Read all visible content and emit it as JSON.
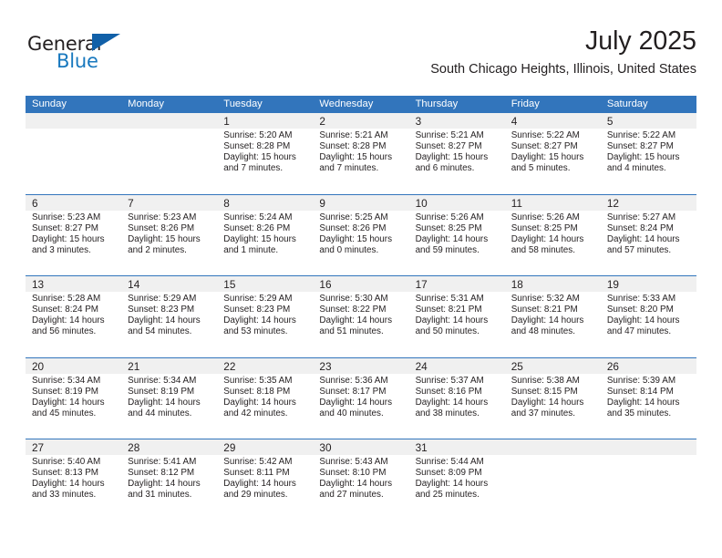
{
  "branding": {
    "logo_primary": "General",
    "logo_secondary": "Blue",
    "logo_triangle_icon": "triangle-icon",
    "colors": {
      "logo_text": "#231f20",
      "logo_blue": "#1878be",
      "logo_triangle": "#1160a8",
      "header_blue": "#3275bc",
      "daynum_strip": "#f0f0f0"
    }
  },
  "header": {
    "title": "July 2025",
    "subtitle": "South Chicago Heights, Illinois, United States"
  },
  "calendar": {
    "weekday_headers": [
      "Sunday",
      "Monday",
      "Tuesday",
      "Wednesday",
      "Thursday",
      "Friday",
      "Saturday"
    ],
    "weeks": [
      [
        {
          "day": "",
          "sunrise": "",
          "sunset": "",
          "daylight_line1": "",
          "daylight_line2": ""
        },
        {
          "day": "",
          "sunrise": "",
          "sunset": "",
          "daylight_line1": "",
          "daylight_line2": ""
        },
        {
          "day": "1",
          "sunrise": "Sunrise: 5:20 AM",
          "sunset": "Sunset: 8:28 PM",
          "daylight_line1": "Daylight: 15 hours",
          "daylight_line2": "and 7 minutes."
        },
        {
          "day": "2",
          "sunrise": "Sunrise: 5:21 AM",
          "sunset": "Sunset: 8:28 PM",
          "daylight_line1": "Daylight: 15 hours",
          "daylight_line2": "and 7 minutes."
        },
        {
          "day": "3",
          "sunrise": "Sunrise: 5:21 AM",
          "sunset": "Sunset: 8:27 PM",
          "daylight_line1": "Daylight: 15 hours",
          "daylight_line2": "and 6 minutes."
        },
        {
          "day": "4",
          "sunrise": "Sunrise: 5:22 AM",
          "sunset": "Sunset: 8:27 PM",
          "daylight_line1": "Daylight: 15 hours",
          "daylight_line2": "and 5 minutes."
        },
        {
          "day": "5",
          "sunrise": "Sunrise: 5:22 AM",
          "sunset": "Sunset: 8:27 PM",
          "daylight_line1": "Daylight: 15 hours",
          "daylight_line2": "and 4 minutes."
        }
      ],
      [
        {
          "day": "6",
          "sunrise": "Sunrise: 5:23 AM",
          "sunset": "Sunset: 8:27 PM",
          "daylight_line1": "Daylight: 15 hours",
          "daylight_line2": "and 3 minutes."
        },
        {
          "day": "7",
          "sunrise": "Sunrise: 5:23 AM",
          "sunset": "Sunset: 8:26 PM",
          "daylight_line1": "Daylight: 15 hours",
          "daylight_line2": "and 2 minutes."
        },
        {
          "day": "8",
          "sunrise": "Sunrise: 5:24 AM",
          "sunset": "Sunset: 8:26 PM",
          "daylight_line1": "Daylight: 15 hours",
          "daylight_line2": "and 1 minute."
        },
        {
          "day": "9",
          "sunrise": "Sunrise: 5:25 AM",
          "sunset": "Sunset: 8:26 PM",
          "daylight_line1": "Daylight: 15 hours",
          "daylight_line2": "and 0 minutes."
        },
        {
          "day": "10",
          "sunrise": "Sunrise: 5:26 AM",
          "sunset": "Sunset: 8:25 PM",
          "daylight_line1": "Daylight: 14 hours",
          "daylight_line2": "and 59 minutes."
        },
        {
          "day": "11",
          "sunrise": "Sunrise: 5:26 AM",
          "sunset": "Sunset: 8:25 PM",
          "daylight_line1": "Daylight: 14 hours",
          "daylight_line2": "and 58 minutes."
        },
        {
          "day": "12",
          "sunrise": "Sunrise: 5:27 AM",
          "sunset": "Sunset: 8:24 PM",
          "daylight_line1": "Daylight: 14 hours",
          "daylight_line2": "and 57 minutes."
        }
      ],
      [
        {
          "day": "13",
          "sunrise": "Sunrise: 5:28 AM",
          "sunset": "Sunset: 8:24 PM",
          "daylight_line1": "Daylight: 14 hours",
          "daylight_line2": "and 56 minutes."
        },
        {
          "day": "14",
          "sunrise": "Sunrise: 5:29 AM",
          "sunset": "Sunset: 8:23 PM",
          "daylight_line1": "Daylight: 14 hours",
          "daylight_line2": "and 54 minutes."
        },
        {
          "day": "15",
          "sunrise": "Sunrise: 5:29 AM",
          "sunset": "Sunset: 8:23 PM",
          "daylight_line1": "Daylight: 14 hours",
          "daylight_line2": "and 53 minutes."
        },
        {
          "day": "16",
          "sunrise": "Sunrise: 5:30 AM",
          "sunset": "Sunset: 8:22 PM",
          "daylight_line1": "Daylight: 14 hours",
          "daylight_line2": "and 51 minutes."
        },
        {
          "day": "17",
          "sunrise": "Sunrise: 5:31 AM",
          "sunset": "Sunset: 8:21 PM",
          "daylight_line1": "Daylight: 14 hours",
          "daylight_line2": "and 50 minutes."
        },
        {
          "day": "18",
          "sunrise": "Sunrise: 5:32 AM",
          "sunset": "Sunset: 8:21 PM",
          "daylight_line1": "Daylight: 14 hours",
          "daylight_line2": "and 48 minutes."
        },
        {
          "day": "19",
          "sunrise": "Sunrise: 5:33 AM",
          "sunset": "Sunset: 8:20 PM",
          "daylight_line1": "Daylight: 14 hours",
          "daylight_line2": "and 47 minutes."
        }
      ],
      [
        {
          "day": "20",
          "sunrise": "Sunrise: 5:34 AM",
          "sunset": "Sunset: 8:19 PM",
          "daylight_line1": "Daylight: 14 hours",
          "daylight_line2": "and 45 minutes."
        },
        {
          "day": "21",
          "sunrise": "Sunrise: 5:34 AM",
          "sunset": "Sunset: 8:19 PM",
          "daylight_line1": "Daylight: 14 hours",
          "daylight_line2": "and 44 minutes."
        },
        {
          "day": "22",
          "sunrise": "Sunrise: 5:35 AM",
          "sunset": "Sunset: 8:18 PM",
          "daylight_line1": "Daylight: 14 hours",
          "daylight_line2": "and 42 minutes."
        },
        {
          "day": "23",
          "sunrise": "Sunrise: 5:36 AM",
          "sunset": "Sunset: 8:17 PM",
          "daylight_line1": "Daylight: 14 hours",
          "daylight_line2": "and 40 minutes."
        },
        {
          "day": "24",
          "sunrise": "Sunrise: 5:37 AM",
          "sunset": "Sunset: 8:16 PM",
          "daylight_line1": "Daylight: 14 hours",
          "daylight_line2": "and 38 minutes."
        },
        {
          "day": "25",
          "sunrise": "Sunrise: 5:38 AM",
          "sunset": "Sunset: 8:15 PM",
          "daylight_line1": "Daylight: 14 hours",
          "daylight_line2": "and 37 minutes."
        },
        {
          "day": "26",
          "sunrise": "Sunrise: 5:39 AM",
          "sunset": "Sunset: 8:14 PM",
          "daylight_line1": "Daylight: 14 hours",
          "daylight_line2": "and 35 minutes."
        }
      ],
      [
        {
          "day": "27",
          "sunrise": "Sunrise: 5:40 AM",
          "sunset": "Sunset: 8:13 PM",
          "daylight_line1": "Daylight: 14 hours",
          "daylight_line2": "and 33 minutes."
        },
        {
          "day": "28",
          "sunrise": "Sunrise: 5:41 AM",
          "sunset": "Sunset: 8:12 PM",
          "daylight_line1": "Daylight: 14 hours",
          "daylight_line2": "and 31 minutes."
        },
        {
          "day": "29",
          "sunrise": "Sunrise: 5:42 AM",
          "sunset": "Sunset: 8:11 PM",
          "daylight_line1": "Daylight: 14 hours",
          "daylight_line2": "and 29 minutes."
        },
        {
          "day": "30",
          "sunrise": "Sunrise: 5:43 AM",
          "sunset": "Sunset: 8:10 PM",
          "daylight_line1": "Daylight: 14 hours",
          "daylight_line2": "and 27 minutes."
        },
        {
          "day": "31",
          "sunrise": "Sunrise: 5:44 AM",
          "sunset": "Sunset: 8:09 PM",
          "daylight_line1": "Daylight: 14 hours",
          "daylight_line2": "and 25 minutes."
        },
        {
          "day": "",
          "sunrise": "",
          "sunset": "",
          "daylight_line1": "",
          "daylight_line2": ""
        },
        {
          "day": "",
          "sunrise": "",
          "sunset": "",
          "daylight_line1": "",
          "daylight_line2": ""
        }
      ]
    ]
  }
}
